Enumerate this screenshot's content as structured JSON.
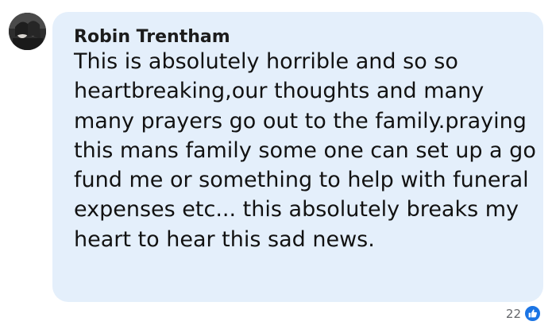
{
  "comment": {
    "author": "Robin Trentham",
    "text": "This is absolutely horrible and so so heartbreaking,our thoughts and many many prayers go out to the family.praying this mans family some one can set up a go fund me or something to help with funeral expenses etc... this absolutely breaks my heart to hear this sad news.",
    "reaction_count": "22",
    "reaction_icon": "thumbs-up-icon"
  },
  "colors": {
    "bubble": "#e4effb",
    "like_blue": "#1b74e4"
  }
}
